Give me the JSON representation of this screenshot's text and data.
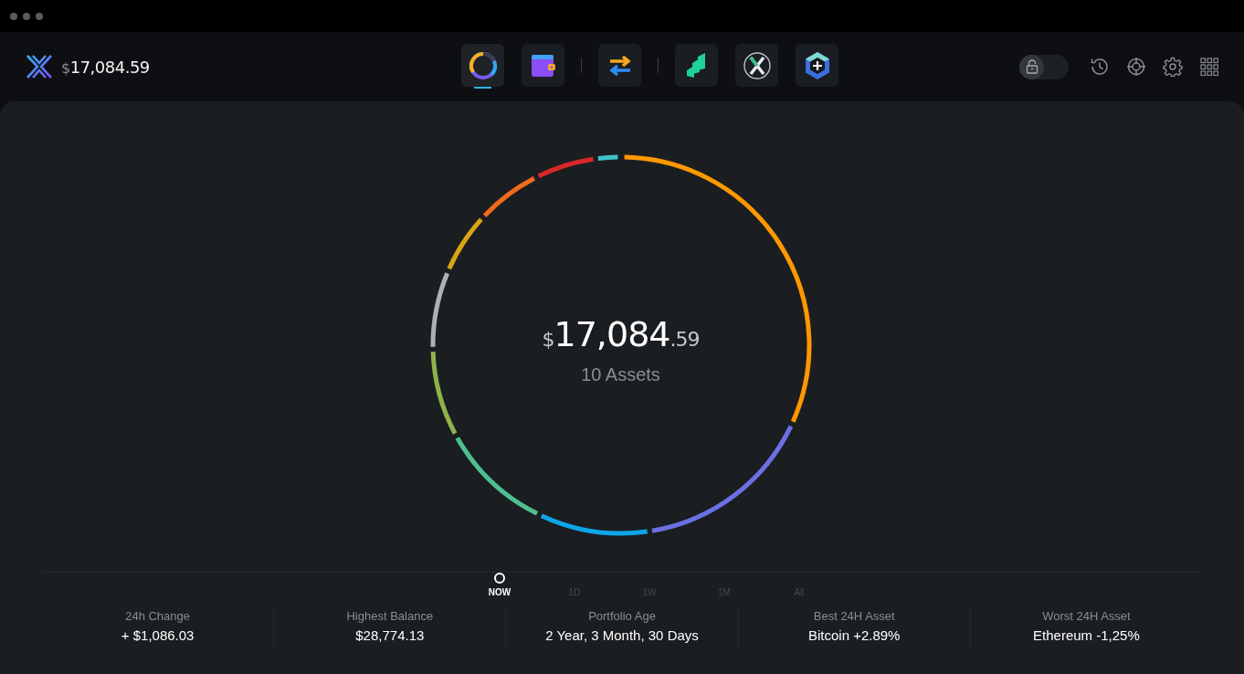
{
  "header": {
    "balance": {
      "currency": "$",
      "amount": "17,084.59"
    }
  },
  "tabs": [
    {
      "selected": true
    },
    {
      "selected": false
    },
    {
      "selected": false
    },
    {
      "selected": false
    },
    {
      "selected": false
    },
    {
      "selected": false
    }
  ],
  "lock_toggle": {
    "on": false
  },
  "portfolio": {
    "currency": "$",
    "whole": "17,084",
    "cents": ".59",
    "assets": "10 Assets"
  },
  "timeline": [
    {
      "label": "NOW",
      "selected": true
    },
    {
      "label": "1D",
      "selected": false
    },
    {
      "label": "1W",
      "selected": false
    },
    {
      "label": "1M",
      "selected": false
    },
    {
      "label": "All",
      "selected": false
    }
  ],
  "stats": [
    {
      "label": "24h Change",
      "value": "+ $1,086.03"
    },
    {
      "label": "Highest Balance",
      "value": "$28,774.13"
    },
    {
      "label": "Portfolio Age",
      "value": "2 Year, 3 Month, 30 Days"
    },
    {
      "label": "Best 24H Asset",
      "value": "Bitcoin +2.89%"
    },
    {
      "label": "Worst 24H Asset",
      "value": "Ethereum -1,25%"
    }
  ]
}
